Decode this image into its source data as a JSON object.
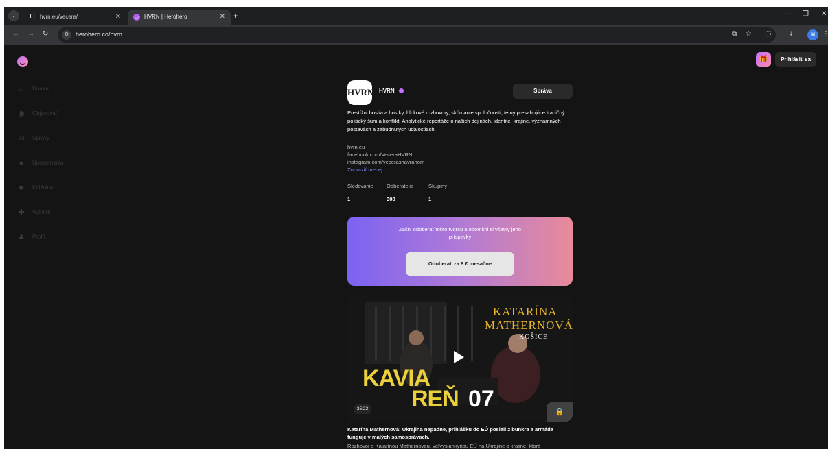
{
  "browser": {
    "tabs": [
      {
        "title": "hvrn.eu/vecera/",
        "favicon": "HVRN-logo-icon",
        "active": false
      },
      {
        "title": "HVRN | Herohero",
        "favicon": "herohero-icon",
        "active": true
      }
    ],
    "url": "herohero.co/hvrn",
    "profile_initial": "M"
  },
  "sidebar": {
    "items": [
      {
        "label": "Domov",
        "icon": "home-icon"
      },
      {
        "label": "Objavovať",
        "icon": "compass-icon"
      },
      {
        "label": "Správy",
        "icon": "message-icon"
      },
      {
        "label": "Upozornenia",
        "icon": "bell-icon"
      },
      {
        "label": "Knižnica",
        "icon": "bookmark-icon"
      },
      {
        "label": "Vytvoriť",
        "icon": "plus-icon"
      },
      {
        "label": "Profil",
        "icon": "user-icon"
      }
    ]
  },
  "header": {
    "login_label": "Prihlásiť sa"
  },
  "creator": {
    "avatar_text": "HVRN",
    "name": "HVRN",
    "message_button": "Správa",
    "bio": "Prestížni hostia a hostky, hĺbkové rozhovory, skúmanie spoločnosti, témy presahujúce tradičný politický šum a konflikt. Analytické reportáže o našich dejinách, identite, krajine, významných postavách a zabudnutých udalostiach.",
    "links": [
      "hvrn.eu",
      "facebook.com/VeceraHVRN",
      "instagram.com/vecerashavranom"
    ],
    "show_less": "Zobraziť menej",
    "stats": [
      {
        "label": "Sledovanie",
        "value": "1"
      },
      {
        "label": "Odberatelia",
        "value": "308"
      },
      {
        "label": "Skupiny",
        "value": "1"
      }
    ]
  },
  "subscribe": {
    "text": "Začni odoberať tohto tvorcu a odomkni si všetky jeho príspevky",
    "button": "Odoberať za 8 € mesačne"
  },
  "post": {
    "thumb_name_line1": "KATARÍNA",
    "thumb_name_line2": "MATHERNOVÁ",
    "thumb_city": "KOŠICE",
    "thumb_show_line1": "KAVIA",
    "thumb_show_line2": "REŇ",
    "thumb_episode": "07",
    "duration": "35:22",
    "title": "Katarína Mathernová: Ukrajina nepadne, prihlášku do EÚ poslali z bunkra a armáda funguje v malých samosprávach.",
    "description": "Rozhovor s Katarínou Mathernovou, veľvyslankyňou EÚ na Ukrajine o krajine, ktorá"
  },
  "colors": {
    "page_bg": "#141414",
    "brand_gradient_start": "#7b63f2",
    "brand_gradient_end": "#e88a9a",
    "accent": "#c470ff",
    "link": "#7a8cff"
  }
}
